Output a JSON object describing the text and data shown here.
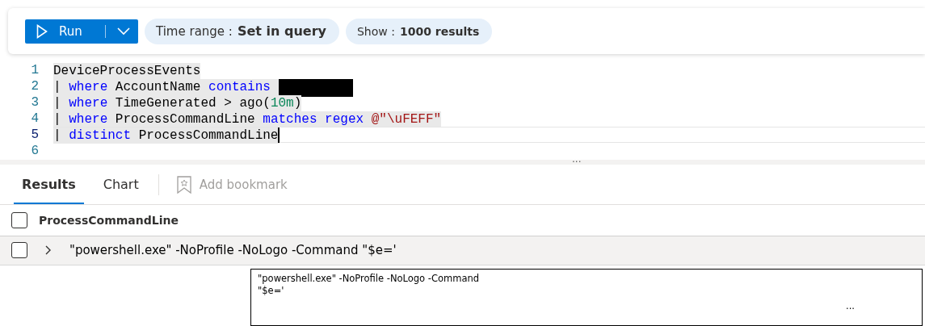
{
  "toolbar": {
    "run_button": "Run",
    "time_range": {
      "label": "Time range :",
      "value": "Set in query"
    },
    "show": {
      "label": "Show :",
      "value": "1000 results"
    }
  },
  "editor": {
    "lines": [
      {
        "number": "1",
        "selected": true,
        "current": false,
        "tokens": [
          {
            "kind": "plain",
            "text": "DeviceProcessEvents"
          }
        ]
      },
      {
        "number": "2",
        "selected": true,
        "current": false,
        "tokens": [
          {
            "kind": "pipe",
            "text": "|"
          },
          {
            "kind": "keyword",
            "text": "where"
          },
          {
            "kind": "plain",
            "text": "AccountName"
          },
          {
            "kind": "keyword",
            "text": "contains"
          },
          {
            "kind": "redacted"
          }
        ]
      },
      {
        "number": "3",
        "selected": true,
        "current": false,
        "tokens": [
          {
            "kind": "pipe",
            "text": "|"
          },
          {
            "kind": "keyword",
            "text": "where"
          },
          {
            "kind": "plain",
            "text": "TimeGenerated > ago("
          },
          {
            "kind": "number",
            "text": "10m"
          },
          {
            "kind": "plain",
            "text": ")"
          }
        ]
      },
      {
        "number": "4",
        "selected": true,
        "current": false,
        "tokens": [
          {
            "kind": "pipe",
            "text": "|"
          },
          {
            "kind": "keyword",
            "text": "where"
          },
          {
            "kind": "plain",
            "text": "ProcessCommandLine"
          },
          {
            "kind": "keyword",
            "text": "matches regex"
          },
          {
            "kind": "string",
            "text": "@\"\\uFEFF\""
          }
        ]
      },
      {
        "number": "5",
        "selected": true,
        "current": true,
        "tokens": [
          {
            "kind": "pipe",
            "text": "|"
          },
          {
            "kind": "keyword",
            "text": "distinct"
          },
          {
            "kind": "plain",
            "text": "ProcessCommandLine"
          }
        ]
      },
      {
        "number": "6",
        "selected": false,
        "current": false
      }
    ]
  },
  "splitter": "...",
  "tabs": [
    {
      "label": "Results",
      "selected": true
    },
    {
      "label": "Chart",
      "selected": false
    }
  ],
  "add_bookmark": {
    "label": "Add bookmark",
    "disabled": true
  },
  "table": {
    "columns": [
      "ProcessCommandLine"
    ],
    "header_checked": false,
    "rows": [
      {
        "checked": false,
        "expanded": false,
        "cells": [
          "\"powershell.exe\" -NoProfile -NoLogo -Command \"$e='"
        ]
      }
    ]
  },
  "tooltip": {
    "lines": [
      "\"powershell.exe\" -NoProfile -NoLogo -Command",
      "\"$e='"
    ],
    "more": "..."
  }
}
